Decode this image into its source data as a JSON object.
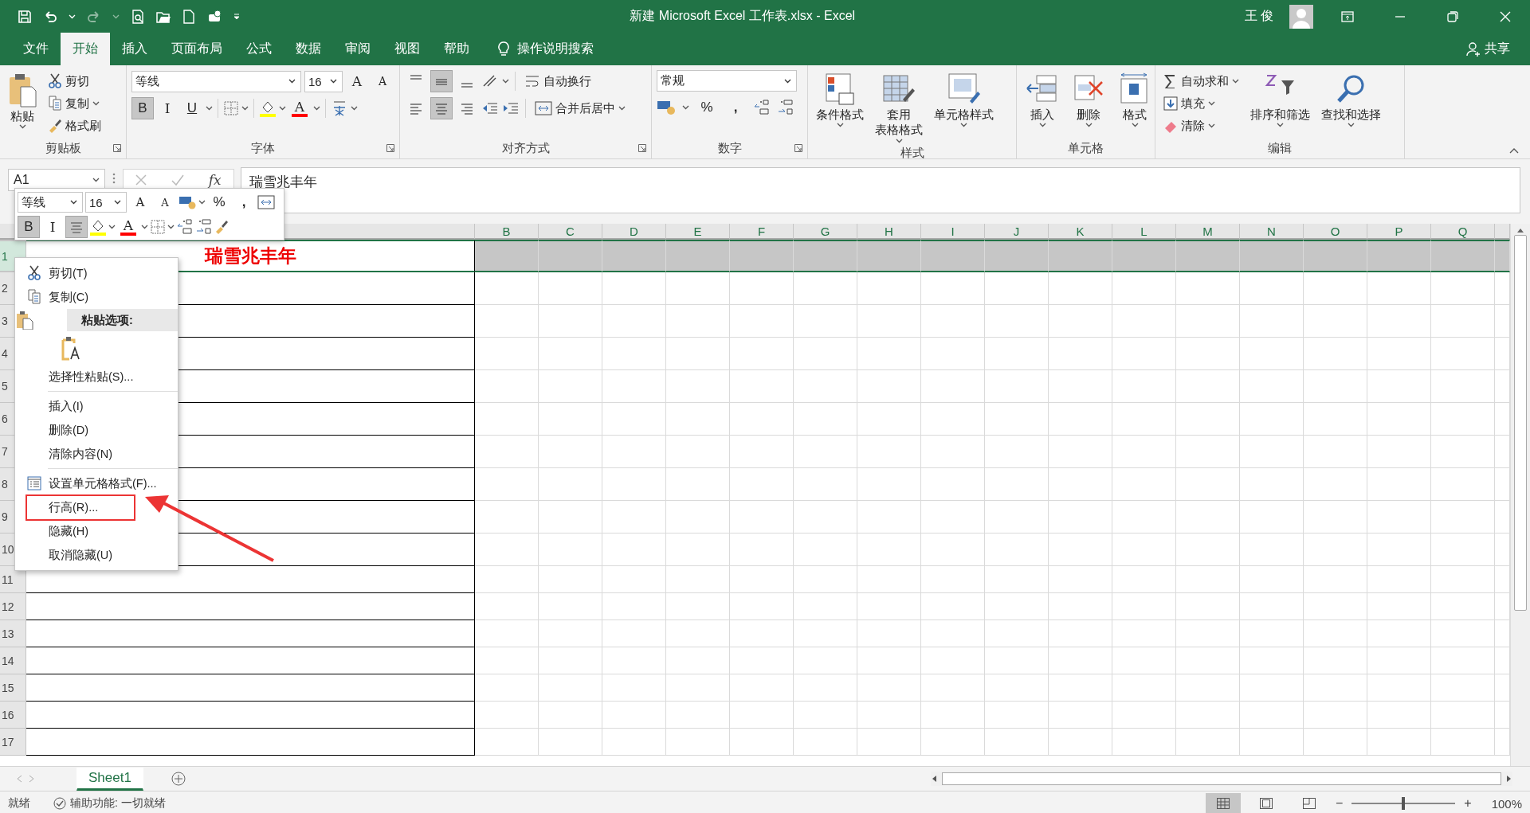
{
  "window": {
    "title": "新建 Microsoft Excel 工作表.xlsx  -  Excel",
    "user": "王 俊"
  },
  "menu_tabs": [
    {
      "label": "文件",
      "selected": false
    },
    {
      "label": "开始",
      "selected": true
    },
    {
      "label": "插入",
      "selected": false
    },
    {
      "label": "页面布局",
      "selected": false
    },
    {
      "label": "公式",
      "selected": false
    },
    {
      "label": "数据",
      "selected": false
    },
    {
      "label": "审阅",
      "selected": false
    },
    {
      "label": "视图",
      "selected": false
    },
    {
      "label": "帮助",
      "selected": false
    }
  ],
  "tell_me": "操作说明搜索",
  "share": "共享",
  "ribbon": [
    {
      "kind": "clipboard",
      "label": "剪贴板",
      "paste": "粘贴",
      "items": [
        "剪切",
        "复制",
        "格式刷"
      ]
    },
    {
      "kind": "font",
      "label": "字体",
      "font": "等线",
      "size": "16",
      "grow": "A",
      "shrink": "A",
      "bold": {
        "label": "B",
        "selected": true
      },
      "italic": {
        "label": "I",
        "selected": false
      },
      "underline": {
        "label": "U",
        "selected": false
      },
      "font_color": "A"
    },
    {
      "kind": "alignment",
      "label": "对齐方式",
      "wrap": "自动换行",
      "merge": "合并后居中",
      "middle_align": true,
      "center": true
    },
    {
      "kind": "number",
      "label": "数字",
      "format": "常规",
      "percent": "%",
      "comma": ","
    },
    {
      "kind": "styles",
      "label": "样式",
      "buttons": [
        {
          "lines": [
            "条件格式"
          ]
        },
        {
          "lines": [
            "套用",
            "表格格式"
          ]
        },
        {
          "lines": [
            "单元格样式"
          ]
        }
      ]
    },
    {
      "kind": "cells",
      "label": "单元格",
      "buttons": [
        "插入",
        "删除",
        "格式"
      ]
    },
    {
      "kind": "editing",
      "label": "编辑",
      "items": [
        "自动求和",
        "填充",
        "清除"
      ],
      "buttons": [
        "排序和筛选",
        "查找和选择"
      ]
    }
  ],
  "formula_bar": {
    "name_box": "A1",
    "fx": "fx",
    "content": "瑞雪兆丰年"
  },
  "mini_toolbar": {
    "font": "等线",
    "size": "16",
    "grow": "A",
    "shrink": "A",
    "percent": "%",
    "comma": ",",
    "bold": {
      "label": "B",
      "selected": true
    },
    "italic": {
      "label": "I",
      "selected": false
    },
    "center": {
      "selected": true
    },
    "font_color": "A"
  },
  "columns": [
    "B",
    "C",
    "D",
    "E",
    "F",
    "G",
    "H",
    "I",
    "J",
    "K",
    "L",
    "M",
    "N",
    "O",
    "P",
    "Q"
  ],
  "rows": [
    {
      "header": "1",
      "cell_a": "瑞雪兆丰年",
      "selected": true
    },
    {
      "header": "2",
      "selected": false
    },
    {
      "header": "3",
      "selected": false
    },
    {
      "header": "4",
      "selected": false
    },
    {
      "header": "5",
      "selected": false
    },
    {
      "header": "6",
      "selected": false
    },
    {
      "header": "7",
      "selected": false
    },
    {
      "header": "8",
      "selected": false
    },
    {
      "header": "9",
      "selected": false
    },
    {
      "header": "10",
      "selected": false
    },
    {
      "header": "11",
      "selected": false
    },
    {
      "header": "12",
      "selected": false
    },
    {
      "header": "13",
      "selected": false
    },
    {
      "header": "14",
      "selected": false
    },
    {
      "header": "15",
      "selected": false
    },
    {
      "header": "16",
      "selected": false
    },
    {
      "header": "17",
      "selected": false
    }
  ],
  "context_menu": [
    {
      "kind": "cut",
      "label": "剪切(T)",
      "annotated": false
    },
    {
      "kind": "copy",
      "label": "复制(C)",
      "annotated": false
    },
    {
      "kind": "header",
      "label": "粘贴选项:"
    },
    {
      "kind": "paste-options"
    },
    {
      "kind": "item",
      "label": "选择性粘贴(S)...",
      "annotated": false
    },
    {
      "kind": "separator"
    },
    {
      "kind": "item",
      "label": "插入(I)",
      "annotated": false
    },
    {
      "kind": "item",
      "label": "删除(D)",
      "annotated": false
    },
    {
      "kind": "item",
      "label": "清除内容(N)",
      "annotated": false
    },
    {
      "kind": "separator"
    },
    {
      "kind": "format",
      "label": "设置单元格格式(F)...",
      "annotated": false
    },
    {
      "kind": "item",
      "label": "行高(R)...",
      "annotated": true
    },
    {
      "kind": "item",
      "label": "隐藏(H)",
      "annotated": false
    },
    {
      "kind": "item",
      "label": "取消隐藏(U)",
      "annotated": false
    }
  ],
  "sheet_tabs": [
    {
      "label": "Sheet1",
      "selected": true
    }
  ],
  "status_bar": {
    "ready": "就绪",
    "accessibility": "辅助功能: 一切就绪",
    "minus": "−",
    "plus": "+",
    "zoom_slider": {
      "level": 0.5
    },
    "zoom": "100%"
  }
}
